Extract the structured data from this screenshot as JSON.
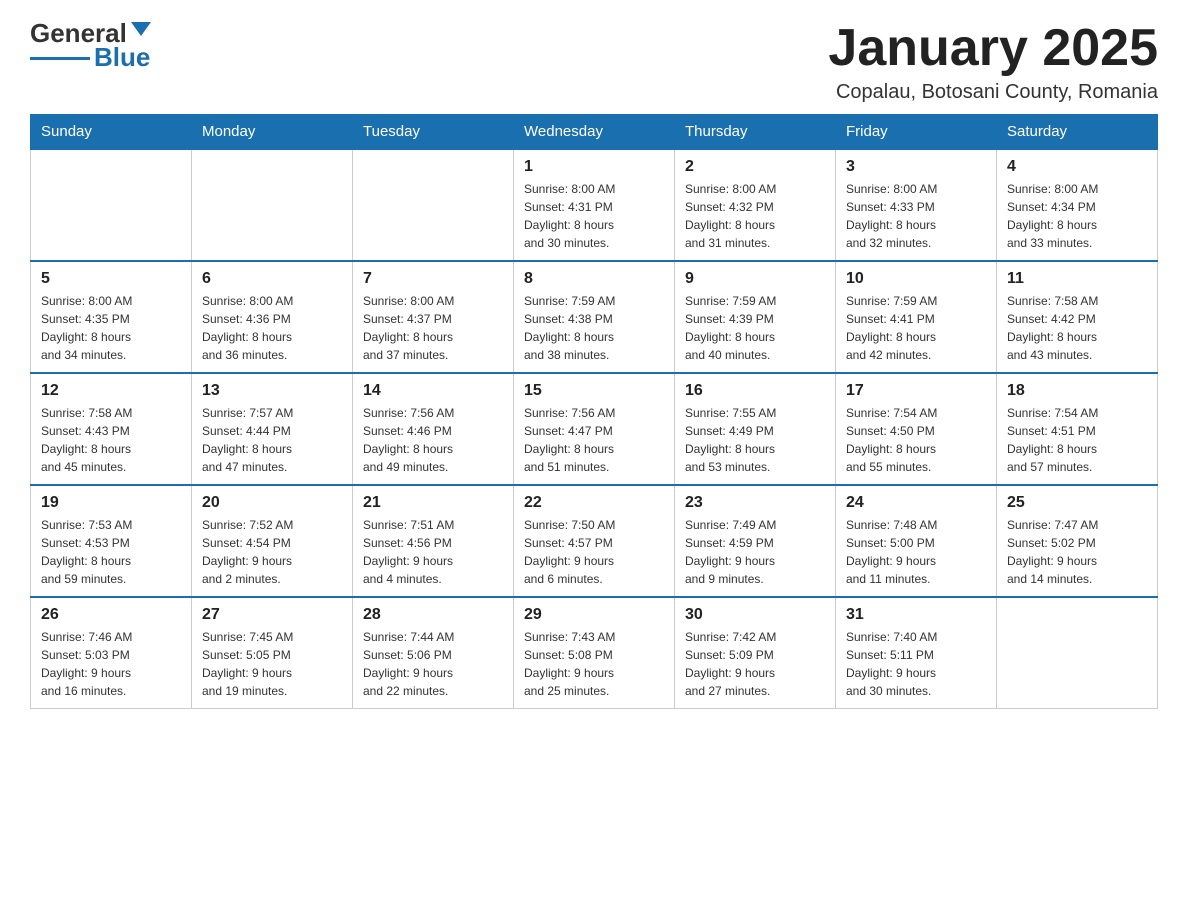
{
  "header": {
    "logo_text_general": "General",
    "logo_text_blue": "Blue",
    "month_title": "January 2025",
    "location": "Copalau, Botosani County, Romania"
  },
  "weekdays": [
    "Sunday",
    "Monday",
    "Tuesday",
    "Wednesday",
    "Thursday",
    "Friday",
    "Saturday"
  ],
  "weeks": [
    {
      "days": [
        {
          "num": "",
          "info": ""
        },
        {
          "num": "",
          "info": ""
        },
        {
          "num": "",
          "info": ""
        },
        {
          "num": "1",
          "info": "Sunrise: 8:00 AM\nSunset: 4:31 PM\nDaylight: 8 hours\nand 30 minutes."
        },
        {
          "num": "2",
          "info": "Sunrise: 8:00 AM\nSunset: 4:32 PM\nDaylight: 8 hours\nand 31 minutes."
        },
        {
          "num": "3",
          "info": "Sunrise: 8:00 AM\nSunset: 4:33 PM\nDaylight: 8 hours\nand 32 minutes."
        },
        {
          "num": "4",
          "info": "Sunrise: 8:00 AM\nSunset: 4:34 PM\nDaylight: 8 hours\nand 33 minutes."
        }
      ]
    },
    {
      "days": [
        {
          "num": "5",
          "info": "Sunrise: 8:00 AM\nSunset: 4:35 PM\nDaylight: 8 hours\nand 34 minutes."
        },
        {
          "num": "6",
          "info": "Sunrise: 8:00 AM\nSunset: 4:36 PM\nDaylight: 8 hours\nand 36 minutes."
        },
        {
          "num": "7",
          "info": "Sunrise: 8:00 AM\nSunset: 4:37 PM\nDaylight: 8 hours\nand 37 minutes."
        },
        {
          "num": "8",
          "info": "Sunrise: 7:59 AM\nSunset: 4:38 PM\nDaylight: 8 hours\nand 38 minutes."
        },
        {
          "num": "9",
          "info": "Sunrise: 7:59 AM\nSunset: 4:39 PM\nDaylight: 8 hours\nand 40 minutes."
        },
        {
          "num": "10",
          "info": "Sunrise: 7:59 AM\nSunset: 4:41 PM\nDaylight: 8 hours\nand 42 minutes."
        },
        {
          "num": "11",
          "info": "Sunrise: 7:58 AM\nSunset: 4:42 PM\nDaylight: 8 hours\nand 43 minutes."
        }
      ]
    },
    {
      "days": [
        {
          "num": "12",
          "info": "Sunrise: 7:58 AM\nSunset: 4:43 PM\nDaylight: 8 hours\nand 45 minutes."
        },
        {
          "num": "13",
          "info": "Sunrise: 7:57 AM\nSunset: 4:44 PM\nDaylight: 8 hours\nand 47 minutes."
        },
        {
          "num": "14",
          "info": "Sunrise: 7:56 AM\nSunset: 4:46 PM\nDaylight: 8 hours\nand 49 minutes."
        },
        {
          "num": "15",
          "info": "Sunrise: 7:56 AM\nSunset: 4:47 PM\nDaylight: 8 hours\nand 51 minutes."
        },
        {
          "num": "16",
          "info": "Sunrise: 7:55 AM\nSunset: 4:49 PM\nDaylight: 8 hours\nand 53 minutes."
        },
        {
          "num": "17",
          "info": "Sunrise: 7:54 AM\nSunset: 4:50 PM\nDaylight: 8 hours\nand 55 minutes."
        },
        {
          "num": "18",
          "info": "Sunrise: 7:54 AM\nSunset: 4:51 PM\nDaylight: 8 hours\nand 57 minutes."
        }
      ]
    },
    {
      "days": [
        {
          "num": "19",
          "info": "Sunrise: 7:53 AM\nSunset: 4:53 PM\nDaylight: 8 hours\nand 59 minutes."
        },
        {
          "num": "20",
          "info": "Sunrise: 7:52 AM\nSunset: 4:54 PM\nDaylight: 9 hours\nand 2 minutes."
        },
        {
          "num": "21",
          "info": "Sunrise: 7:51 AM\nSunset: 4:56 PM\nDaylight: 9 hours\nand 4 minutes."
        },
        {
          "num": "22",
          "info": "Sunrise: 7:50 AM\nSunset: 4:57 PM\nDaylight: 9 hours\nand 6 minutes."
        },
        {
          "num": "23",
          "info": "Sunrise: 7:49 AM\nSunset: 4:59 PM\nDaylight: 9 hours\nand 9 minutes."
        },
        {
          "num": "24",
          "info": "Sunrise: 7:48 AM\nSunset: 5:00 PM\nDaylight: 9 hours\nand 11 minutes."
        },
        {
          "num": "25",
          "info": "Sunrise: 7:47 AM\nSunset: 5:02 PM\nDaylight: 9 hours\nand 14 minutes."
        }
      ]
    },
    {
      "days": [
        {
          "num": "26",
          "info": "Sunrise: 7:46 AM\nSunset: 5:03 PM\nDaylight: 9 hours\nand 16 minutes."
        },
        {
          "num": "27",
          "info": "Sunrise: 7:45 AM\nSunset: 5:05 PM\nDaylight: 9 hours\nand 19 minutes."
        },
        {
          "num": "28",
          "info": "Sunrise: 7:44 AM\nSunset: 5:06 PM\nDaylight: 9 hours\nand 22 minutes."
        },
        {
          "num": "29",
          "info": "Sunrise: 7:43 AM\nSunset: 5:08 PM\nDaylight: 9 hours\nand 25 minutes."
        },
        {
          "num": "30",
          "info": "Sunrise: 7:42 AM\nSunset: 5:09 PM\nDaylight: 9 hours\nand 27 minutes."
        },
        {
          "num": "31",
          "info": "Sunrise: 7:40 AM\nSunset: 5:11 PM\nDaylight: 9 hours\nand 30 minutes."
        },
        {
          "num": "",
          "info": ""
        }
      ]
    }
  ]
}
